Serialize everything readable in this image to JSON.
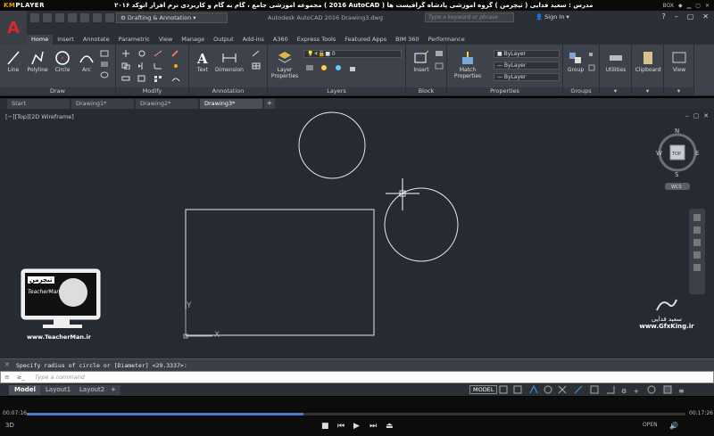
{
  "player": {
    "logo_a": "KM",
    "logo_b": "PLAYER",
    "caption": "مجموعه آموزشی جامع ، گام به گام و کاربردی نرم افزار اتوکد ۲۰۱۶ ( 2016 AutoCAD )   مدرس : سعید فدایی ( تیچرمن ) گروه آموزشی پادشاه گرافیست ها",
    "box_label": "BOX",
    "time_elapsed": "00:07:16",
    "time_total": "00:17:26",
    "progress": 0.42,
    "open_label": "OPEN",
    "sub_label": "3D"
  },
  "acad": {
    "workspace": "Drafting & Annotation",
    "doc_title": "Autodesk AutoCAD 2016   Drawing3.dwg",
    "search_placeholder": "Type a keyword or phrase",
    "signin": "Sign In",
    "ribbon_tabs": [
      "Home",
      "Insert",
      "Annotate",
      "Parametric",
      "View",
      "Manage",
      "Output",
      "Add-ins",
      "A360",
      "Express Tools",
      "Featured Apps",
      "BIM 360",
      "Performance"
    ],
    "panels": {
      "draw": "Draw",
      "modify": "Modify",
      "annotation": "Annotation",
      "layers": "Layers",
      "block": "Block",
      "properties": "Properties",
      "groups": "Groups"
    },
    "tools": {
      "line": "Line",
      "polyline": "Polyline",
      "circle": "Circle",
      "arc": "Arc",
      "text": "Text",
      "dimension": "Dimension",
      "layer_properties": "Layer Properties",
      "insert": "Insert",
      "match_properties": "Match Properties",
      "group": "Group",
      "utilities": "Utilities",
      "clipboard": "Clipboard",
      "view": "View"
    },
    "layer_value": "0",
    "bylayer": "ByLayer",
    "file_tabs": [
      "Start",
      "Drawing1*",
      "Drawing2*",
      "Drawing3*"
    ],
    "view_label": "[−][Top][2D Wireframe]",
    "viewcube": {
      "n": "N",
      "s": "S",
      "e": "E",
      "w": "W",
      "top": "TOP",
      "wcs": "WCS"
    },
    "command_history": "Specify radius of circle or [Diameter] <29.3337>:",
    "command_prefix": "≥_",
    "command_placeholder": "Type a command",
    "layout_tabs": [
      "Model",
      "Layout1",
      "Layout2"
    ],
    "model_button": "MODEL"
  },
  "watermarks": {
    "teacher_badge": "تیچرمن",
    "teacher_name": "TeacherMan",
    "teacher_url": "www.TeacherMan.ir",
    "gfx_name": "سعید فدایی",
    "gfx_url": "www.GfxKing.ir"
  }
}
